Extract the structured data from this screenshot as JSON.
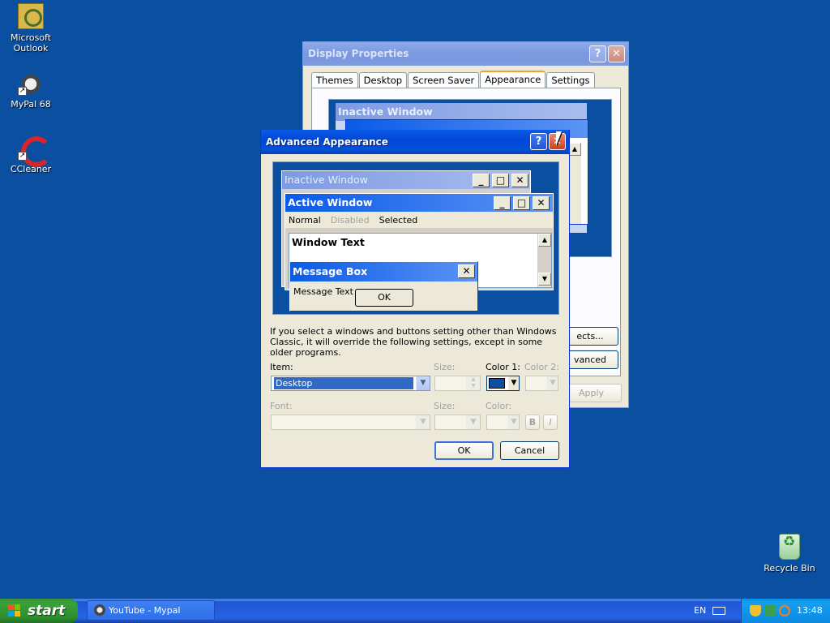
{
  "desktop": {
    "icons": [
      {
        "label": "Microsoft Outlook"
      },
      {
        "label": "MyPal 68"
      },
      {
        "label": "CCleaner"
      },
      {
        "label": "Recycle Bin"
      }
    ]
  },
  "display_properties": {
    "title": "Display Properties",
    "tabs": [
      {
        "label": "Themes"
      },
      {
        "label": "Desktop"
      },
      {
        "label": "Screen Saver"
      },
      {
        "label": "Appearance"
      },
      {
        "label": "Settings"
      }
    ],
    "active_tab": "Appearance",
    "preview": {
      "inactive_title": "Inactive Window"
    },
    "effects_button": "ects...",
    "advanced_button": "vanced",
    "apply_button": "Apply"
  },
  "advanced_appearance": {
    "title": "Advanced Appearance",
    "preview": {
      "inactive_title": "Inactive Window",
      "active_title": "Active Window",
      "menu": {
        "normal": "Normal",
        "disabled": "Disabled",
        "selected": "Selected"
      },
      "window_text": "Window Text",
      "message_box": {
        "title": "Message Box",
        "text": "Message Text",
        "ok": "OK"
      }
    },
    "info_text": "If you select a windows and buttons setting other than Windows Classic, it will override the following settings, except in some older programs.",
    "item": {
      "label": "Item:",
      "value": "Desktop"
    },
    "size1": {
      "label": "Size:"
    },
    "color1": {
      "label": "Color 1:",
      "value_hex": "#0a4fa0"
    },
    "color2": {
      "label": "Color 2:"
    },
    "font": {
      "label": "Font:"
    },
    "size2": {
      "label": "Size:"
    },
    "color3": {
      "label": "Color:"
    },
    "bold_button": "B",
    "italic_button": "I",
    "ok_button": "OK",
    "cancel_button": "Cancel"
  },
  "taskbar": {
    "start_label": "start",
    "tasks": [
      {
        "label": "YouTube - Mypal"
      }
    ],
    "language": "EN",
    "clock": "13:48"
  },
  "colors": {
    "desktop": "#0a4fa0",
    "title_active": "#0246d6",
    "taskbar": "#2663e0",
    "start_green": "#37a337"
  }
}
